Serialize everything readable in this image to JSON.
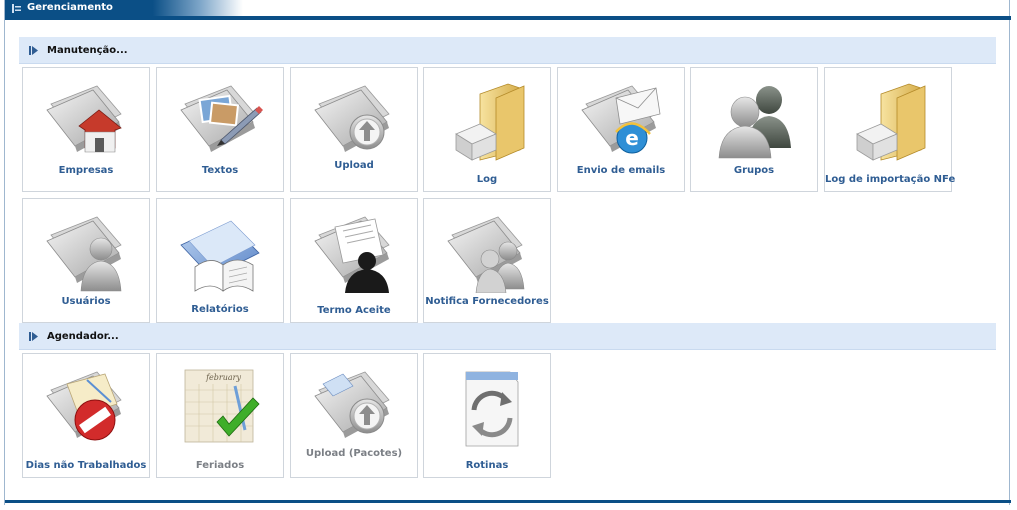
{
  "window": {
    "title": "Gerenciamento"
  },
  "sections": [
    {
      "title": "Manutenção...",
      "tiles": [
        {
          "label": "Empresas",
          "icon": "house-folder-icon",
          "enabled": true
        },
        {
          "label": "Textos",
          "icon": "pencil-folder-icon",
          "enabled": true
        },
        {
          "label": "Upload",
          "icon": "upload-folder-icon",
          "enabled": true
        },
        {
          "label": "Log",
          "icon": "log-folder-icon",
          "enabled": true
        },
        {
          "label": "Envio de emails",
          "icon": "email-folder-icon",
          "enabled": true
        },
        {
          "label": "Grupos",
          "icon": "group-users-icon",
          "enabled": true
        },
        {
          "label": "Log de importação NFe",
          "icon": "log-import-folder-icon",
          "enabled": true
        },
        {
          "label": "Usuários",
          "icon": "user-folder-icon",
          "enabled": true
        },
        {
          "label": "Relatórios",
          "icon": "reports-book-icon",
          "enabled": true
        },
        {
          "label": "Termo Aceite",
          "icon": "terms-person-icon",
          "enabled": true
        },
        {
          "label": "Notifica Fornecedores",
          "icon": "notify-suppliers-icon",
          "enabled": true
        }
      ]
    },
    {
      "title": "Agendador...",
      "tiles": [
        {
          "label": "Dias não Trabalhados",
          "icon": "no-entry-calendar-icon",
          "enabled": true
        },
        {
          "label": "Feriados",
          "icon": "calendar-check-icon",
          "enabled": false
        },
        {
          "label": "Upload (Pacotes)",
          "icon": "upload-packages-folder-icon",
          "enabled": false
        },
        {
          "label": "Rotinas",
          "icon": "routine-refresh-icon",
          "enabled": true
        }
      ]
    }
  ],
  "colors": {
    "title_bar": "#0b4f86",
    "section_header_bg": "#dde9f8",
    "tile_label": "#2f5d93",
    "tile_label_disabled": "#7b7f85"
  }
}
